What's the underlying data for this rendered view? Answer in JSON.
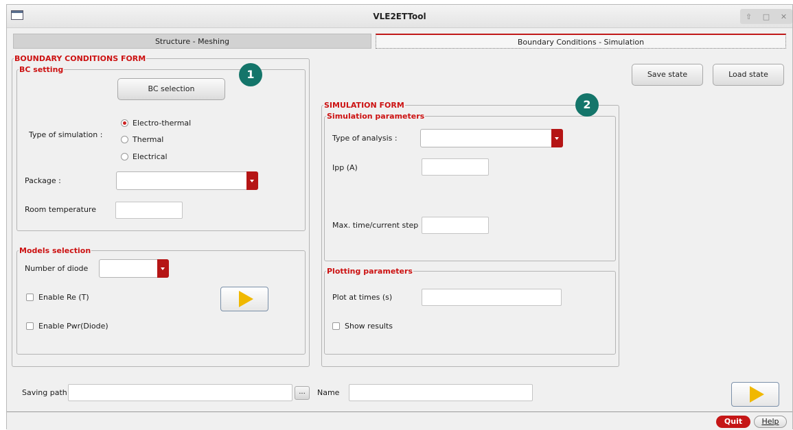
{
  "window": {
    "title": "VLE2ETTool"
  },
  "tabs": [
    {
      "label": "Structure - Meshing"
    },
    {
      "label": "Boundary Conditions - Simulation"
    }
  ],
  "bc_form": {
    "title": "BOUNDARY CONDITIONS FORM",
    "bc_setting": {
      "title": "BC setting",
      "bc_selection_button": "BC selection",
      "simulation_type_label": "Type of simulation :",
      "simulation_types": [
        "Electro-thermal",
        "Thermal",
        "Electrical"
      ],
      "selected_type": "Electro-thermal",
      "package_label": "Package :",
      "package_value": "",
      "room_temp_label": "Room temperature",
      "room_temp_value": ""
    },
    "models": {
      "title": "Models selection",
      "num_diode_label": "Number of diode",
      "num_diode_value": "",
      "enable_re_label": "Enable Re (T)",
      "enable_pwr_label": "Enable Pwr(Diode)"
    }
  },
  "sim_form": {
    "title": "SIMULATION FORM",
    "sim_params": {
      "title": "Simulation parameters",
      "analysis_label": "Type of analysis :",
      "analysis_value": "",
      "ipp_label": "Ipp (A)",
      "ipp_value": "",
      "max_step_label": "Max. time/current step",
      "max_step_value": ""
    },
    "plot_params": {
      "title": "Plotting parameters",
      "plot_times_label": "Plot at times (s)",
      "plot_times_value": "",
      "show_results_label": "Show results"
    }
  },
  "top_buttons": {
    "save_state": "Save state",
    "load_state": "Load state"
  },
  "badges": [
    "1",
    "2"
  ],
  "bottom": {
    "saving_path_label": "Saving path",
    "saving_path_value": "",
    "browse_label": "...",
    "name_label": "Name",
    "name_value": ""
  },
  "footer": {
    "quit": "Quit",
    "help": "Help"
  },
  "colors": {
    "accent_red": "#cc1111",
    "badge_teal": "#14756a",
    "play_yellow": "#f0b800"
  }
}
